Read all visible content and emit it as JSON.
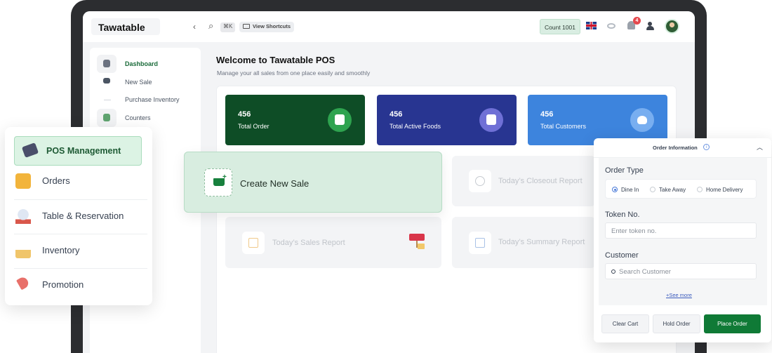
{
  "app": {
    "brand": "Tawatable"
  },
  "topbar": {
    "back_icon": "chevron-left-icon",
    "search_icon": "search-icon",
    "search_shortcut": "⌘K",
    "shortcuts_label": "View Shortcuts",
    "count_label": "Count 1001",
    "language_icon": "uk-flag-icon",
    "visibility_icon": "eye-icon",
    "notification_icon": "bell-icon",
    "notification_count": "4",
    "team_icon": "users-icon"
  },
  "sidebar": {
    "items": [
      {
        "label": "Dashboard",
        "icon": "dashboard-icon",
        "active": true
      },
      {
        "label": "New Sale",
        "icon": "trend-icon"
      },
      {
        "label": "Purchase Inventory",
        "icon": "inventory-icon"
      },
      {
        "label": "Counters",
        "icon": "counter-icon"
      }
    ]
  },
  "main": {
    "title": "Welcome to Tawatable POS",
    "subtitle": "Manage your all sales from one place easily and smoothly",
    "stats": [
      {
        "value": "456",
        "label": "Total Order",
        "color": "#0e4d26",
        "icon": "shopping-bag-check-icon"
      },
      {
        "value": "456",
        "label": "Total Active Foods",
        "color": "#283591",
        "icon": "food-boxes-icon"
      },
      {
        "value": "456",
        "label": "Total Customers",
        "color": "#3d84dd",
        "icon": "user-icon"
      }
    ],
    "reports": {
      "closeout": "Today’s Closeout Report",
      "sales": "Today’s Sales Report",
      "summary": "Today’s Summary Report"
    }
  },
  "pos_menu": {
    "items": [
      {
        "label": "POS Management",
        "icon": "pos-card-icon",
        "active": true
      },
      {
        "label": "Orders",
        "icon": "orders-icon"
      },
      {
        "label": "Table & Reservation",
        "icon": "table-reservation-icon"
      },
      {
        "label": "Inventory",
        "icon": "inventory-box-icon"
      },
      {
        "label": "Promotion",
        "icon": "megaphone-icon"
      }
    ]
  },
  "create_sale": {
    "label": "Create New Sale",
    "icon": "cart-plus-icon"
  },
  "order_info": {
    "title": "Order Information",
    "order_type_label": "Order Type",
    "order_types": [
      "Dine In",
      "Take Away",
      "Home Delivery"
    ],
    "selected_order_type": "Dine In",
    "token_label": "Token No.",
    "token_placeholder": "Enter token no.",
    "customer_label": "Customer",
    "customer_placeholder": "Search Customer",
    "see_more": "+See more",
    "buttons": {
      "clear": "Clear Cart",
      "hold": "Hold Order",
      "place": "Place Order"
    }
  },
  "colors": {
    "accent": "#0f7a36",
    "brand_dark": "#0e4d26"
  }
}
